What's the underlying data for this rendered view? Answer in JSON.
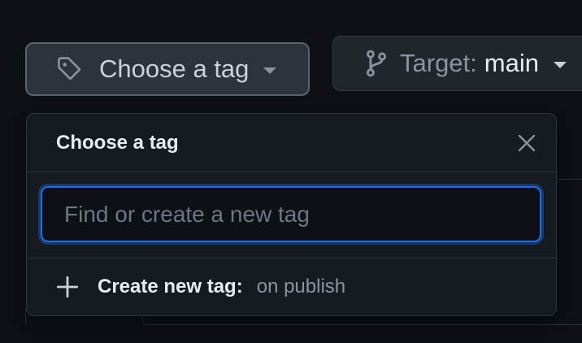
{
  "tag_button": {
    "label": "Choose a tag",
    "icon": "tag-icon"
  },
  "target_button": {
    "label": "Target:",
    "value": "main",
    "icon": "git-branch-icon"
  },
  "dropdown": {
    "title": "Choose a tag",
    "close_icon": "close-icon",
    "search": {
      "placeholder": "Find or create a new tag",
      "value": ""
    },
    "create": {
      "icon": "plus-icon",
      "label": "Create new tag:",
      "value": "on publish"
    }
  },
  "colors": {
    "background": "#0d1117",
    "accent": "#1f6feb",
    "text": "#e6edf3",
    "muted": "#8b949e"
  }
}
